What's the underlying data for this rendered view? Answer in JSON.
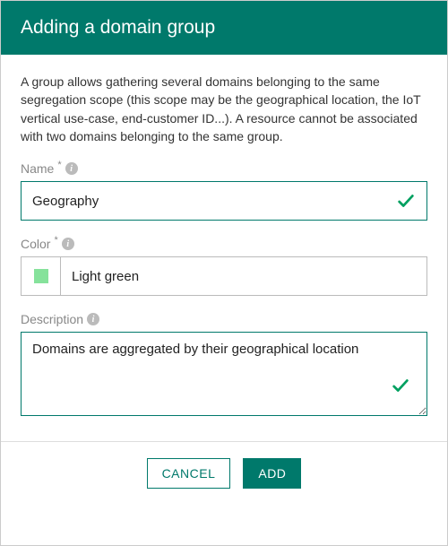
{
  "header": {
    "title": "Adding a domain group"
  },
  "intro": "A group allows gathering several domains belonging to the same segregation scope (this scope may be the geographical location, the IoT vertical use-case, end-customer ID...). A resource cannot be associated with two domains belonging to the same group.",
  "fields": {
    "name": {
      "label": "Name",
      "value": "Geography",
      "required": true,
      "valid": true
    },
    "color": {
      "label": "Color",
      "valueLabel": "Light green",
      "swatch": "#86e29b",
      "required": true
    },
    "description": {
      "label": "Description",
      "value": "Domains are aggregated by their geographical location",
      "required": false,
      "valid": true
    }
  },
  "buttons": {
    "cancel": "CANCEL",
    "add": "ADD"
  },
  "colors": {
    "accent": "#00796b",
    "check": "#00a060"
  }
}
